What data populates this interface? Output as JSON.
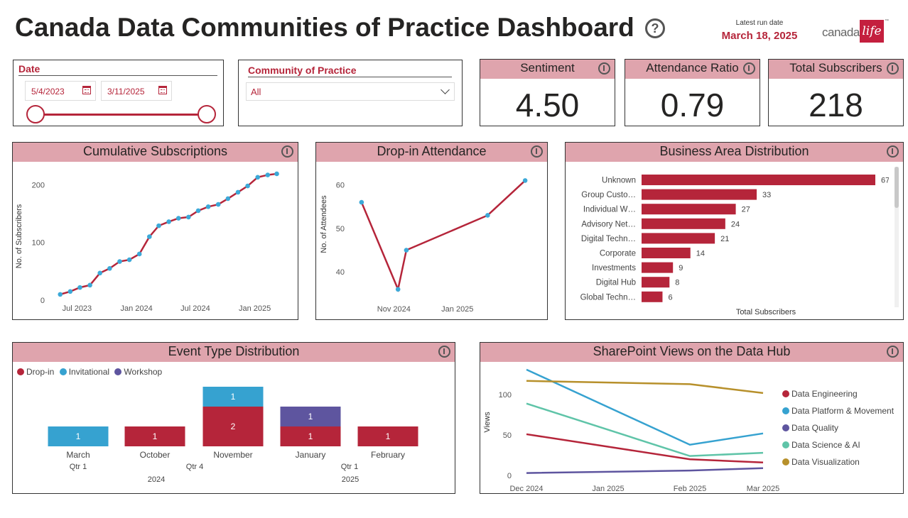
{
  "header": {
    "title": "Canada Data Communities of Practice Dashboard",
    "help_icon": "question-circle-icon",
    "run_date_label": "Latest run date",
    "run_date": "March 18, 2025",
    "logo_text": "canada",
    "logo_word": "life",
    "logo_tm": "™"
  },
  "date_slicer": {
    "label": "Date",
    "start": "5/4/2023",
    "end": "3/11/2025",
    "range_start_fraction": 0,
    "range_end_fraction": 1
  },
  "community_slicer": {
    "label": "Community of Practice",
    "selected": "All"
  },
  "kpis": [
    {
      "label": "Sentiment",
      "value": "4.50"
    },
    {
      "label": "Attendance Ratio",
      "value": "0.79"
    },
    {
      "label": "Total Subscribers",
      "value": "218"
    }
  ],
  "panels": {
    "cumulative": "Cumulative Subscriptions",
    "dropin": "Drop-in Attendance",
    "business": "Business Area Distribution",
    "event": "Event Type Distribution",
    "sharepoint": "SharePoint Views on the Data Hub"
  },
  "colors": {
    "accent": "#b5253a",
    "header_bg": "#dfa4ad",
    "point": "#3ca9d8",
    "dropin": "#b5253a",
    "invitational": "#36a2d0",
    "workshop": "#5e559f"
  },
  "chart_data": [
    {
      "name": "cumulative",
      "type": "line",
      "ylabel": "No. of Subscribers",
      "yticks": [
        "200",
        "100",
        "0"
      ],
      "xticks": [
        "Jul 2023",
        "Jan 2024",
        "Jul 2024",
        "Jan 2025"
      ],
      "ylim": [
        0,
        230
      ],
      "xlim": [
        "2023-05-04",
        "2025-03-11"
      ],
      "points": [
        [
          "2023-05-10",
          10
        ],
        [
          "2023-06-10",
          15
        ],
        [
          "2023-07-10",
          22
        ],
        [
          "2023-08-10",
          26
        ],
        [
          "2023-09-10",
          47
        ],
        [
          "2023-10-10",
          55
        ],
        [
          "2023-11-10",
          67
        ],
        [
          "2023-12-10",
          70
        ],
        [
          "2024-01-10",
          80
        ],
        [
          "2024-02-10",
          110
        ],
        [
          "2024-03-10",
          129
        ],
        [
          "2024-04-10",
          136
        ],
        [
          "2024-05-10",
          142
        ],
        [
          "2024-06-10",
          144
        ],
        [
          "2024-07-10",
          155
        ],
        [
          "2024-08-10",
          162
        ],
        [
          "2024-09-10",
          166
        ],
        [
          "2024-10-10",
          176
        ],
        [
          "2024-11-10",
          187
        ],
        [
          "2024-12-10",
          198
        ],
        [
          "2025-01-10",
          213
        ],
        [
          "2025-02-10",
          217
        ],
        [
          "2025-03-10",
          219
        ]
      ]
    },
    {
      "name": "dropin",
      "type": "line",
      "ylabel": "No. of Attendees",
      "yticks": [
        "60",
        "50",
        "40"
      ],
      "xticks": [
        "Nov 2024",
        "Jan 2025"
      ],
      "ylim": [
        34,
        64
      ],
      "xlim": [
        "2024-09-27",
        "2025-03-11"
      ],
      "points": [
        [
          "2024-10-01",
          56
        ],
        [
          "2024-11-05",
          36
        ],
        [
          "2024-11-13",
          45
        ],
        [
          "2025-01-30",
          53
        ],
        [
          "2025-03-07",
          61
        ]
      ]
    },
    {
      "name": "business",
      "type": "bar",
      "xlabel": "Total Subscribers",
      "categories": [
        "Unknown",
        "Group Custo…",
        "Individual W…",
        "Advisory Net…",
        "Digital Techn…",
        "Corporate",
        "Investments",
        "Digital Hub",
        "Global Techn…"
      ],
      "values": [
        67,
        33,
        27,
        24,
        21,
        14,
        9,
        8,
        6
      ],
      "xlim": [
        0,
        67
      ]
    },
    {
      "name": "event",
      "type": "bar",
      "legend": [
        {
          "name": "Drop-in",
          "color": "#b5253a"
        },
        {
          "name": "Invitational",
          "color": "#36a2d0"
        },
        {
          "name": "Workshop",
          "color": "#5e559f"
        }
      ],
      "categories": [
        "March",
        "October",
        "November",
        "January",
        "February"
      ],
      "quarters": [
        "Qtr 1",
        "Qtr 4",
        "Qtr 1"
      ],
      "years": [
        "2024",
        "2025"
      ],
      "series": [
        {
          "name": "Drop-in",
          "values": [
            0,
            1,
            2,
            1,
            1
          ]
        },
        {
          "name": "Invitational",
          "values": [
            1,
            0,
            1,
            0,
            0
          ]
        },
        {
          "name": "Workshop",
          "values": [
            0,
            0,
            0,
            1,
            0
          ]
        }
      ],
      "ylim": [
        0,
        3
      ]
    },
    {
      "name": "sharepoint",
      "type": "line",
      "ylabel": "Views",
      "yticks": [
        "100",
        "50",
        "0"
      ],
      "ylim": [
        0,
        130
      ],
      "categories": [
        "Dec 2024",
        "Jan 2025",
        "Feb 2025",
        "Mar 2025"
      ],
      "series": [
        {
          "name": "Data Engineering",
          "color": "#b5253a",
          "points": [
            [
              0,
              51
            ],
            [
              2,
              20
            ],
            [
              3,
              16
            ]
          ]
        },
        {
          "name": "Data Platform & Movement",
          "color": "#36a2d0",
          "points": [
            [
              0,
              131
            ],
            [
              2,
              38
            ],
            [
              3,
              52
            ]
          ]
        },
        {
          "name": "Data Quality",
          "color": "#5e559f",
          "points": [
            [
              0,
              3
            ],
            [
              2,
              6
            ],
            [
              3,
              9
            ]
          ]
        },
        {
          "name": "Data Science & AI",
          "color": "#5fc4a8",
          "points": [
            [
              0,
              89
            ],
            [
              2,
              24
            ],
            [
              3,
              28
            ]
          ]
        },
        {
          "name": "Data Visualization",
          "color": "#b7902b",
          "points": [
            [
              0,
              117
            ],
            [
              2,
              113
            ],
            [
              3,
              102
            ]
          ]
        }
      ]
    }
  ]
}
